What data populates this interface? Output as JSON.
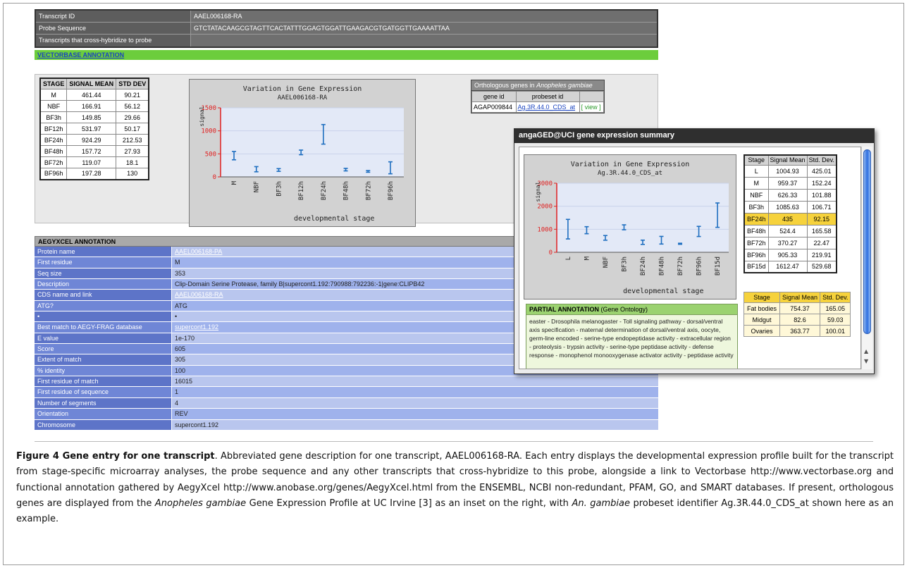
{
  "header": {
    "rows": [
      {
        "key": "Transcript ID",
        "value": "AAEL006168-RA"
      },
      {
        "key": "Probe Sequence",
        "value": "GTCTATACAAGCGTAGTTCACTATTTGGAGTGGATTGAAGACGTGATGGTTGAAAATTAA"
      },
      {
        "key": "Transcripts that cross-hybridize to probe",
        "value": ""
      }
    ],
    "vectorbase_link": "VECTORBASE ANNOTATION"
  },
  "stage_table": {
    "headers": [
      "STAGE",
      "SIGNAL MEAN",
      "STD DEV"
    ],
    "rows": [
      [
        "M",
        "461.44",
        "90.21"
      ],
      [
        "NBF",
        "166.91",
        "56.12"
      ],
      [
        "BF3h",
        "149.85",
        "29.66"
      ],
      [
        "BF12h",
        "531.97",
        "50.17"
      ],
      [
        "BF24h",
        "924.29",
        "212.53"
      ],
      [
        "BF48h",
        "157.72",
        "27.93"
      ],
      [
        "BF72h",
        "119.07",
        "18.1"
      ],
      [
        "BF96h",
        "197.28",
        "130"
      ]
    ]
  },
  "orthologs": {
    "title_prefix": "Orthologous genes in ",
    "title_species": "Anopheles gambiae",
    "headers": [
      "gene id",
      "probeset id",
      ""
    ],
    "row": {
      "gene_id": "AGAP009844",
      "probeset_id": "Ag.3R.44.0_CDS_at",
      "view": "[ view ]"
    }
  },
  "annotation": {
    "heading": "AEGYXCEL ANNOTATION",
    "rows": [
      {
        "key": "Protein name",
        "value": "AAEL006168-PA",
        "link": true
      },
      {
        "key": "First residue",
        "value": "M",
        "link": false
      },
      {
        "key": "Seq size",
        "value": "353",
        "link": false
      },
      {
        "key": "Description",
        "value": "Clip-Domain Serine Protease, family B|supercont1.192:790988:792236:-1|gene:CLIPB42",
        "link": false
      },
      {
        "key": "CDS name and link",
        "value": "AAEL006168-RA",
        "link": true
      },
      {
        "key": "ATG?",
        "value": "ATG",
        "link": false
      },
      {
        "key": "•",
        "value": "•",
        "link": false
      },
      {
        "key": "Best match to AEGY-FRAG database",
        "value": "supercont1.192",
        "link": true
      },
      {
        "key": "E value",
        "value": "1e-170",
        "link": false
      },
      {
        "key": "Score",
        "value": "605",
        "link": false
      },
      {
        "key": "Extent of match",
        "value": "305",
        "link": false
      },
      {
        "key": "% identity",
        "value": "100",
        "link": false
      },
      {
        "key": "First residue of match",
        "value": "16015",
        "link": false
      },
      {
        "key": "First residue of sequence",
        "value": "1",
        "link": false
      },
      {
        "key": "Number of segments",
        "value": "4",
        "link": false
      },
      {
        "key": "Orientation",
        "value": "REV",
        "link": false
      },
      {
        "key": "Chromosome",
        "value": "supercont1.192",
        "link": false
      }
    ]
  },
  "inset": {
    "title": "angaGED@UCI gene expression summary",
    "stage_table": {
      "headers": [
        "Stage",
        "Signal Mean",
        "Std. Dev."
      ],
      "rows": [
        [
          "L",
          "1004.93",
          "425.01"
        ],
        [
          "M",
          "959.37",
          "152.24"
        ],
        [
          "NBF",
          "626.33",
          "101.88"
        ],
        [
          "BF3h",
          "1085.63",
          "106.71"
        ],
        [
          "BF24h",
          "435",
          "92.15"
        ],
        [
          "BF48h",
          "524.4",
          "165.58"
        ],
        [
          "BF72h",
          "370.27",
          "22.47"
        ],
        [
          "BF96h",
          "905.33",
          "219.91"
        ],
        [
          "BF15d",
          "1612.47",
          "529.68"
        ]
      ],
      "highlighted_row": 4,
      "highlight_color": "#f6d23c"
    },
    "tissue_table": {
      "headers": [
        "Stage",
        "Signal Mean",
        "Std. Dev."
      ],
      "rows": [
        [
          "Fat bodies",
          "754.37",
          "165.05"
        ],
        [
          "Midgut",
          "82.6",
          "59.03"
        ],
        [
          "Ovaries",
          "363.77",
          "100.01"
        ]
      ]
    },
    "partial_annotation": {
      "heading_bold": "PARTIAL ANNOTATION",
      "heading_rest": " (Gene Ontology)",
      "text": "easter - Drosophila melanogaster - Toll signaling pathway - dorsal/ventral axis specification - maternal determination of dorsal/ventral axis, oocyte, germ-line encoded - serine-type endopeptidase activity - extracellular region - proteolysis - trypsin activity - serine-type peptidase activity - defense response - monophenol monooxygenase activator activity - peptidase activity"
    }
  },
  "chart_data": [
    {
      "type": "scatter",
      "title": "Variation in Gene Expression",
      "subtitle": "AAEL006168-RA",
      "xlabel": "developmental stage",
      "ylabel": "signal",
      "categories": [
        "M",
        "NBF",
        "BF3h",
        "BF12h",
        "BF24h",
        "BF48h",
        "BF72h",
        "BF96h"
      ],
      "y": [
        461.44,
        166.91,
        149.85,
        531.97,
        924.29,
        157.72,
        119.07,
        197.28
      ],
      "err": [
        90.21,
        56.12,
        29.66,
        50.17,
        212.53,
        27.93,
        18.1,
        130
      ],
      "yticks": [
        "0",
        "500",
        "1000",
        "1500"
      ],
      "ylim": [
        0,
        1500
      ],
      "axis_color": "#e02020",
      "bar_color": "#1f6fc0",
      "plot_bg": "#e3e9f7"
    },
    {
      "type": "scatter",
      "title": "Variation in Gene Expression",
      "subtitle": "Ag.3R.44.0_CDS_at",
      "xlabel": "developmental stage",
      "ylabel": "signal",
      "categories": [
        "L",
        "M",
        "NBF",
        "BF3h",
        "BF24h",
        "BF48h",
        "BF72h",
        "BF96h",
        "BF15d"
      ],
      "y": [
        1004.93,
        959.37,
        626.33,
        1085.63,
        435,
        524.4,
        370.27,
        905.33,
        1612.47
      ],
      "err": [
        425.01,
        152.24,
        101.88,
        106.71,
        92.15,
        165.58,
        22.47,
        219.91,
        529.68
      ],
      "yticks": [
        "0",
        "1000",
        "2000",
        "3000"
      ],
      "ylim": [
        0,
        3000
      ],
      "axis_color": "#e02020",
      "bar_color": "#1f6fc0",
      "plot_bg": "#e3e9f7"
    }
  ],
  "caption": {
    "label": "Figure 4 Gene entry for one transcript",
    "body_1": ". Abbreviated gene description for one transcript, AAEL006168-RA. Each entry displays the developmental expression profile built for the transcript from stage-specific microarray analyses, the probe sequence and any other transcripts that cross-hybridize to this probe, alongside a link to Vectorbase http://www.vectorbase.org and functional annotation gathered by AegyXcel http://www.anobase.org/genes/AegyXcel.html from the ENSEMBL, NCBI non-redundant, PFAM, GO, and SMART databases. If present, orthologous genes are displayed from the ",
    "species_1": "Anopheles gambiae",
    "body_2": " Gene Expression Profile at UC Irvine [3] as an inset on the right, with ",
    "species_2": "An. gambiae",
    "body_3": " probeset identifier Ag.3R.44.0_CDS_at shown here as an example."
  }
}
